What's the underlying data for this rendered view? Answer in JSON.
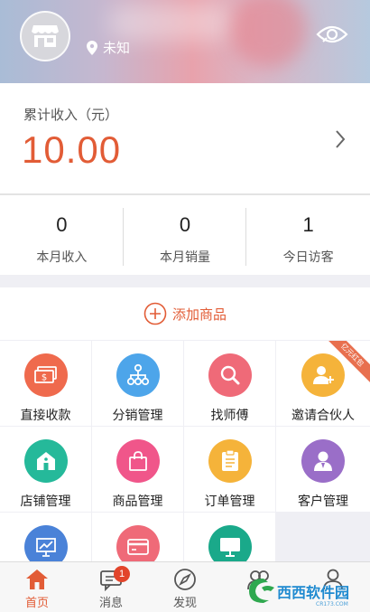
{
  "header": {
    "location": "未知",
    "icons": [
      "store-icon",
      "location-pin-icon",
      "eye-icon"
    ]
  },
  "income": {
    "label": "累计收入（元）",
    "amount": "10.00"
  },
  "stats": [
    {
      "value": "0",
      "label": "本月收入"
    },
    {
      "value": "0",
      "label": "本月销量"
    },
    {
      "value": "1",
      "label": "今日访客"
    }
  ],
  "add_product": {
    "label": "添加商品"
  },
  "grid": [
    {
      "label": "直接收款",
      "icon": "cash-icon",
      "color": "#ef6a4d"
    },
    {
      "label": "分销管理",
      "icon": "org-chart-icon",
      "color": "#4da5ea"
    },
    {
      "label": "找师傅",
      "icon": "search-icon",
      "color": "#ef6a78"
    },
    {
      "label": "邀请合伙人",
      "icon": "add-user-icon",
      "color": "#f5b33a",
      "ribbon": "亿元红包"
    },
    {
      "label": "店铺管理",
      "icon": "home-icon",
      "color": "#25b99a"
    },
    {
      "label": "商品管理",
      "icon": "bag-icon",
      "color": "#f0568a"
    },
    {
      "label": "订单管理",
      "icon": "clipboard-icon",
      "color": "#f5b33a"
    },
    {
      "label": "客户管理",
      "icon": "customer-icon",
      "color": "#9a6ec8"
    },
    {
      "label": "",
      "icon": "chart-board-icon",
      "color": "#4a82d8"
    },
    {
      "label": "",
      "icon": "card-icon",
      "color": "#ef6a78"
    },
    {
      "label": "",
      "icon": "monitor-icon",
      "color": "#1aa98a"
    }
  ],
  "tabbar": [
    {
      "label": "首页",
      "icon": "home-tab-icon",
      "active": true
    },
    {
      "label": "消息",
      "icon": "message-icon",
      "badge": "1"
    },
    {
      "label": "发现",
      "icon": "compass-icon"
    },
    {
      "label": "",
      "icon": "contacts-icon"
    },
    {
      "label": "",
      "icon": "profile-icon"
    }
  ],
  "watermark": {
    "text": "西西软件园",
    "sub": "CR173.COM"
  },
  "colors": {
    "accent": "#e25c36",
    "badge": "#e2452c"
  }
}
